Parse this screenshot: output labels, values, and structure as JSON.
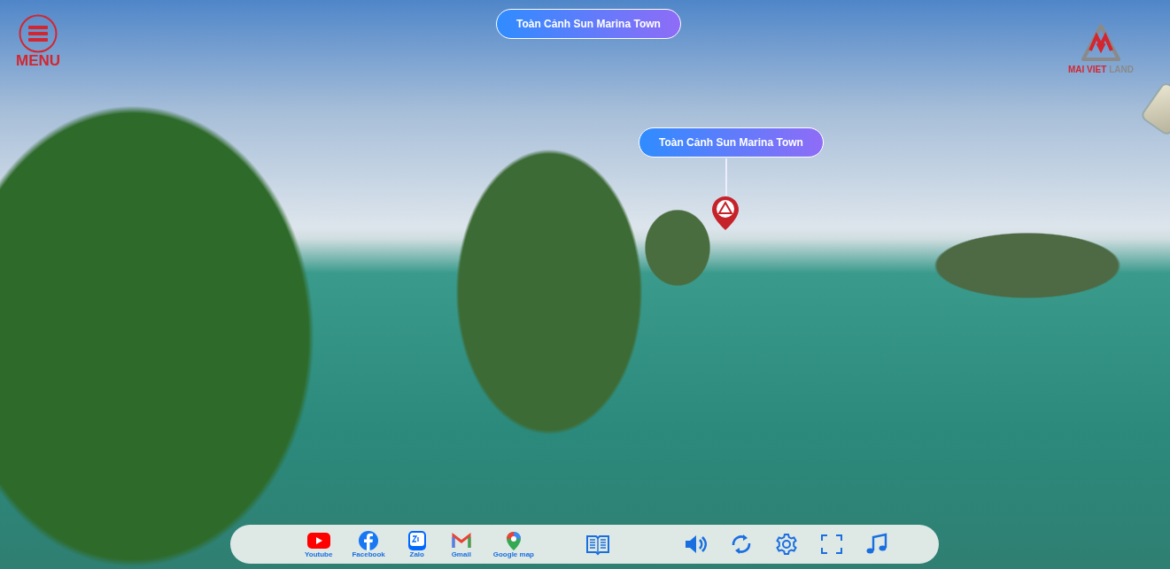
{
  "title_button": {
    "label": "Toàn Cảnh Sun Marina Town"
  },
  "menu": {
    "label": "MENU"
  },
  "logo": {
    "name_red": "MAI VIET",
    "name_gray": "LAND"
  },
  "hotspot": {
    "label": "Toàn Cảnh Sun Marina Town"
  },
  "toolbar": {
    "links": [
      {
        "kind": "youtube",
        "label": "Youtube"
      },
      {
        "kind": "facebook",
        "label": "Facebook"
      },
      {
        "kind": "zalo",
        "label": "Zalo"
      },
      {
        "kind": "gmail",
        "label": "Gmail"
      },
      {
        "kind": "maps",
        "label": "Google map"
      }
    ],
    "controls": [
      {
        "kind": "book"
      },
      {
        "kind": "sound"
      },
      {
        "kind": "rotate"
      },
      {
        "kind": "settings"
      },
      {
        "kind": "fullscreen"
      },
      {
        "kind": "music"
      }
    ]
  }
}
